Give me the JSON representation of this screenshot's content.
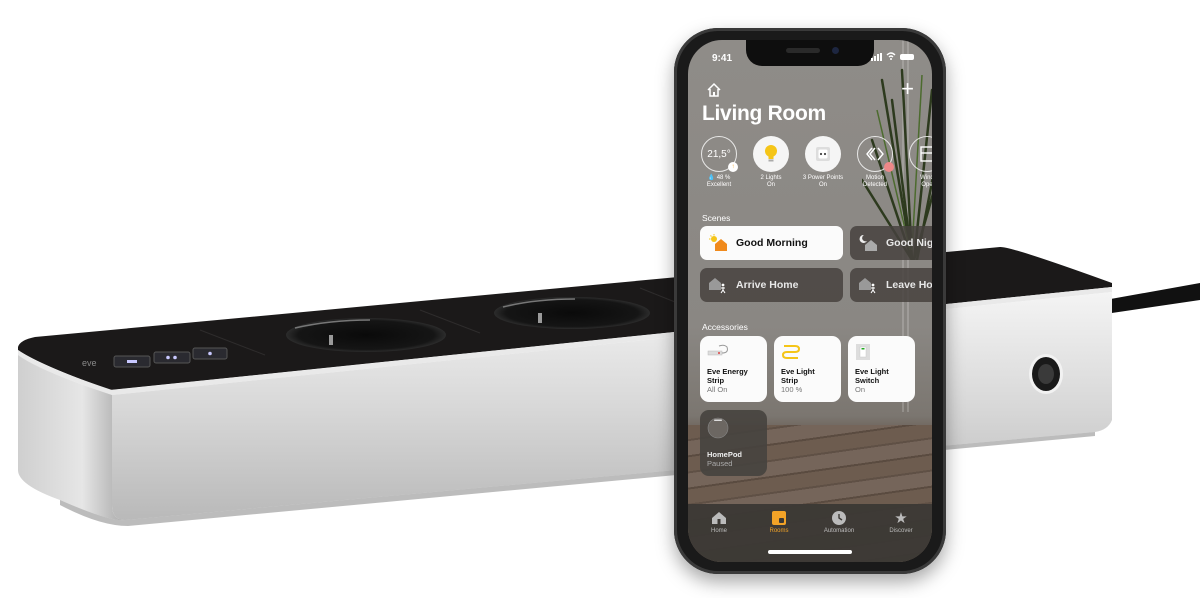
{
  "product": {
    "name": "power-strip",
    "socket_count": 3,
    "button_count": 3
  },
  "phone": {
    "status_bar": {
      "time": "9:41"
    },
    "room_title": "Living Room",
    "status_tiles": [
      {
        "id": "climate",
        "value": "21,5°",
        "line1": "💧 48 %",
        "line2": "Excellent"
      },
      {
        "id": "lights",
        "line1": "2 Lights",
        "line2": "On"
      },
      {
        "id": "power",
        "line1": "3 Power Points",
        "line2": "On"
      },
      {
        "id": "motion",
        "line1": "Motion",
        "line2": "Detected"
      },
      {
        "id": "window",
        "line1": "Wind",
        "line2": "Ope"
      }
    ],
    "scenes_label": "Scenes",
    "scenes": [
      {
        "label": "Good Morning",
        "active": true,
        "icon": "sun-house-icon"
      },
      {
        "label": "Good Nig",
        "active": false,
        "icon": "moon-house-icon"
      },
      {
        "label": "Arrive Home",
        "active": false,
        "icon": "arrive-home-icon"
      },
      {
        "label": "Leave Ho",
        "active": false,
        "icon": "leave-home-icon"
      }
    ],
    "accessories_label": "Accessories",
    "accessories": [
      {
        "name1": "Eve Energy",
        "name2": "Strip",
        "state": "All On",
        "icon": "energy-strip-icon"
      },
      {
        "name1": "Eve Light",
        "name2": "Strip",
        "state": "100 %",
        "icon": "light-strip-icon"
      },
      {
        "name1": "Eve Light",
        "name2": "Switch",
        "state": "On",
        "icon": "light-switch-icon"
      },
      {
        "name1": "HomePod",
        "name2": "",
        "state": "Paused",
        "icon": "homepod-icon"
      }
    ],
    "tabs": [
      {
        "label": "Home",
        "active": false
      },
      {
        "label": "Rooms",
        "active": true
      },
      {
        "label": "Automation",
        "active": false
      },
      {
        "label": "Discover",
        "active": false
      }
    ],
    "colors": {
      "accent": "#f3a327",
      "bulb": "#f5c518"
    }
  }
}
